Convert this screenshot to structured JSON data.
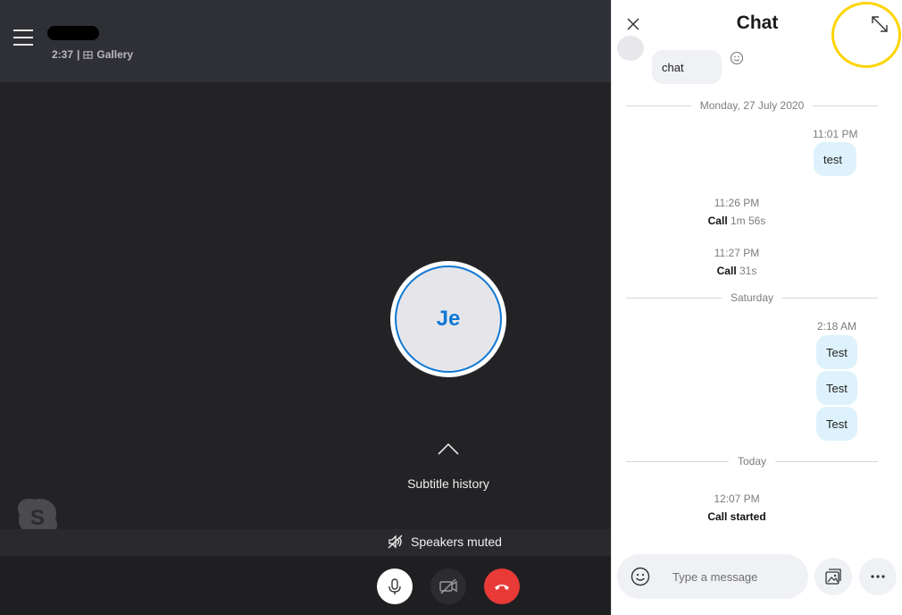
{
  "call": {
    "name_redacted": "",
    "duration": "2:37",
    "separator": "|",
    "view_mode": "Gallery",
    "participant_initials": "Je",
    "subtitle_history_label": "Subtitle history",
    "speakers_status": "Speakers muted",
    "icons": {
      "menu": "hamburger-icon",
      "gallery": "gallery-icon",
      "chevron": "chevron-up-icon",
      "skype": "skype-logo",
      "speaker_muted": "speaker-muted-icon",
      "mic": "microphone-icon",
      "video": "video-off-icon",
      "hangup": "hang-up-icon"
    }
  },
  "chat": {
    "title": "Chat",
    "messages_top": {
      "incoming_text": "chat"
    },
    "divider_1": "Monday, 27 July 2020",
    "out_1": {
      "time": "11:01 PM",
      "text": "test"
    },
    "call_1": {
      "time": "11:26 PM",
      "label": "Call",
      "duration": "1m 56s"
    },
    "call_2": {
      "time": "11:27 PM",
      "label": "Call",
      "duration": "31s"
    },
    "divider_2": "Saturday",
    "out_2": {
      "time": "2:18 AM",
      "texts": [
        "Test",
        "Test",
        "Test"
      ]
    },
    "divider_3": "Today",
    "call_3": {
      "time": "12:07 PM",
      "label": "Call started"
    },
    "composer_placeholder": "Type a message",
    "colors": {
      "accent": "#0f78d4",
      "hangup": "#e83a37",
      "annotation": "#ffd400",
      "outgoing_bubble": "#ddf2fc",
      "incoming_bubble": "#eff1f5"
    }
  }
}
